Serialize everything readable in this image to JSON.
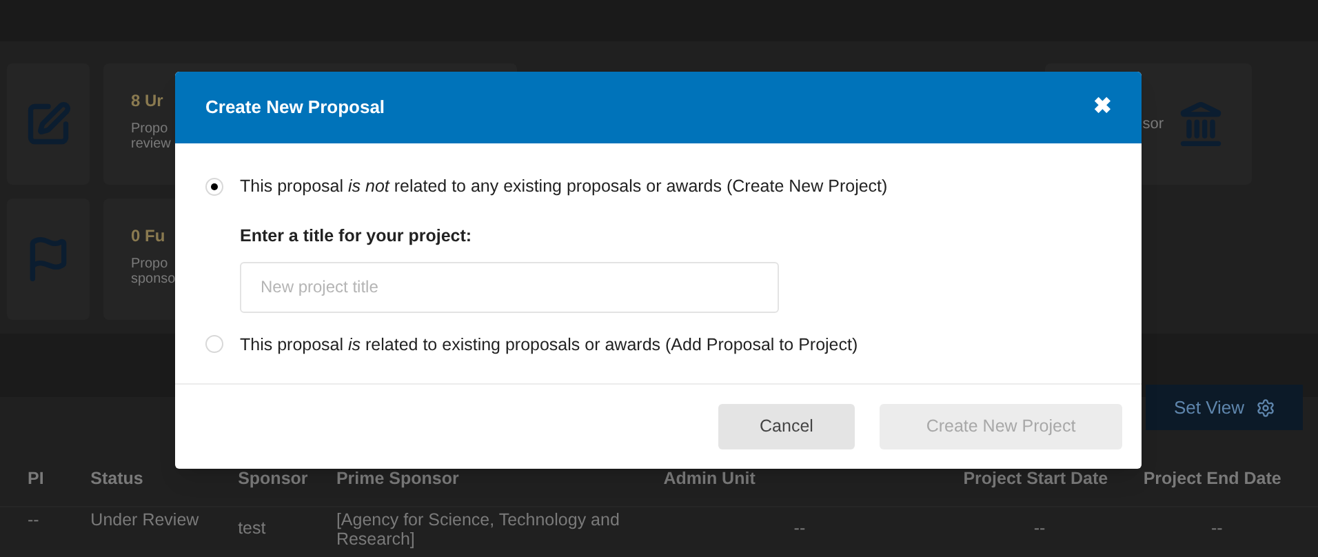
{
  "summary_cards": [
    {
      "kind": "edit",
      "count": "8 Ur",
      "lines": [
        "Propo",
        "review"
      ]
    },
    {
      "kind": "flag",
      "count": "0 Fu",
      "lines": [
        "Propo",
        "sponso"
      ]
    }
  ],
  "right_card": {
    "kind": "bank",
    "text": "sor"
  },
  "set_view_button": {
    "label": "Set View"
  },
  "table": {
    "columns": [
      "PI",
      "Status",
      "Sponsor",
      "Prime Sponsor",
      "Admin Unit",
      "Project Start Date",
      "Project End Date"
    ],
    "rows": [
      [
        "--",
        "Under Review",
        "test",
        "[Agency for Science, Technology and Research]",
        "--",
        "--",
        "--"
      ]
    ]
  },
  "dialog": {
    "title": "Create New Proposal",
    "close": "✖",
    "options": [
      {
        "label": "This proposal *is not* related to any existing proposals or awards (Create New Project)",
        "selected": true
      },
      {
        "label": "This proposal *is* related to existing proposals or awards (Add Proposal to Project)",
        "selected": false
      }
    ],
    "field": {
      "label": "Enter a title for your project:",
      "placeholder": "New project title"
    },
    "buttons": [
      {
        "label": "Cancel",
        "disabled": false
      },
      {
        "label": "Create New Project",
        "disabled": true
      }
    ]
  }
}
